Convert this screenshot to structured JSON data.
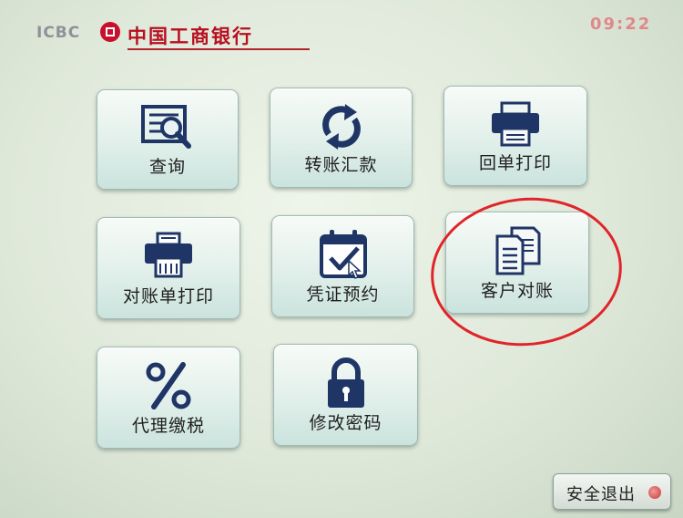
{
  "header": {
    "brand_en": "ICBC",
    "brand_cn": "中国工商银行",
    "status": "",
    "clock": "09:22"
  },
  "menu": [
    {
      "label": "查询",
      "icon": "search-icon"
    },
    {
      "label": "转账汇款",
      "icon": "transfer-arrows-icon"
    },
    {
      "label": "回单打印",
      "icon": "printer-icon"
    },
    {
      "label": "对账单打印",
      "icon": "statement-printer-icon"
    },
    {
      "label": "凭证预约",
      "icon": "calendar-check-icon"
    },
    {
      "label": "客户对账",
      "icon": "documents-icon"
    },
    {
      "label": "代理缴税",
      "icon": "percent-icon"
    },
    {
      "label": "修改密码",
      "icon": "lock-icon"
    }
  ],
  "exit": {
    "label": "安全退出"
  },
  "colors": {
    "brand_red": "#c8102e",
    "icon_navy": "#1f3566",
    "annotation_red": "#e0242a"
  }
}
